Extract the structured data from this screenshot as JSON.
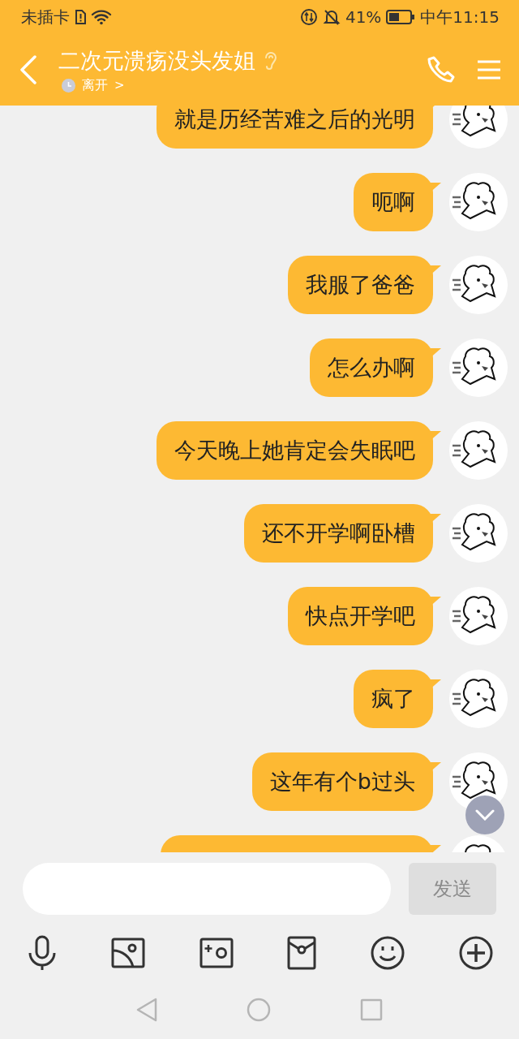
{
  "status_bar": {
    "carrier": "未插卡",
    "battery": "41%",
    "time": "中午11:15"
  },
  "header": {
    "title": "二次元溃疡没头发姐",
    "presence": "离开",
    "presence_arrow": ">"
  },
  "messages": [
    {
      "text": "就是历经苦难之后的光明",
      "partial": false
    },
    {
      "text": "呃啊",
      "partial": false
    },
    {
      "text": "我服了爸爸",
      "partial": false
    },
    {
      "text": "怎么办啊",
      "partial": false
    },
    {
      "text": "今天晚上她肯定会失眠吧",
      "partial": false
    },
    {
      "text": "还不开学啊卧槽",
      "partial": false
    },
    {
      "text": "快点开学吧",
      "partial": false
    },
    {
      "text": "疯了",
      "partial": false
    },
    {
      "text": "这年有个b过头",
      "partial": false
    },
    {
      "partial": true
    }
  ],
  "send_button": {
    "label": "发送",
    "disabled": true
  }
}
